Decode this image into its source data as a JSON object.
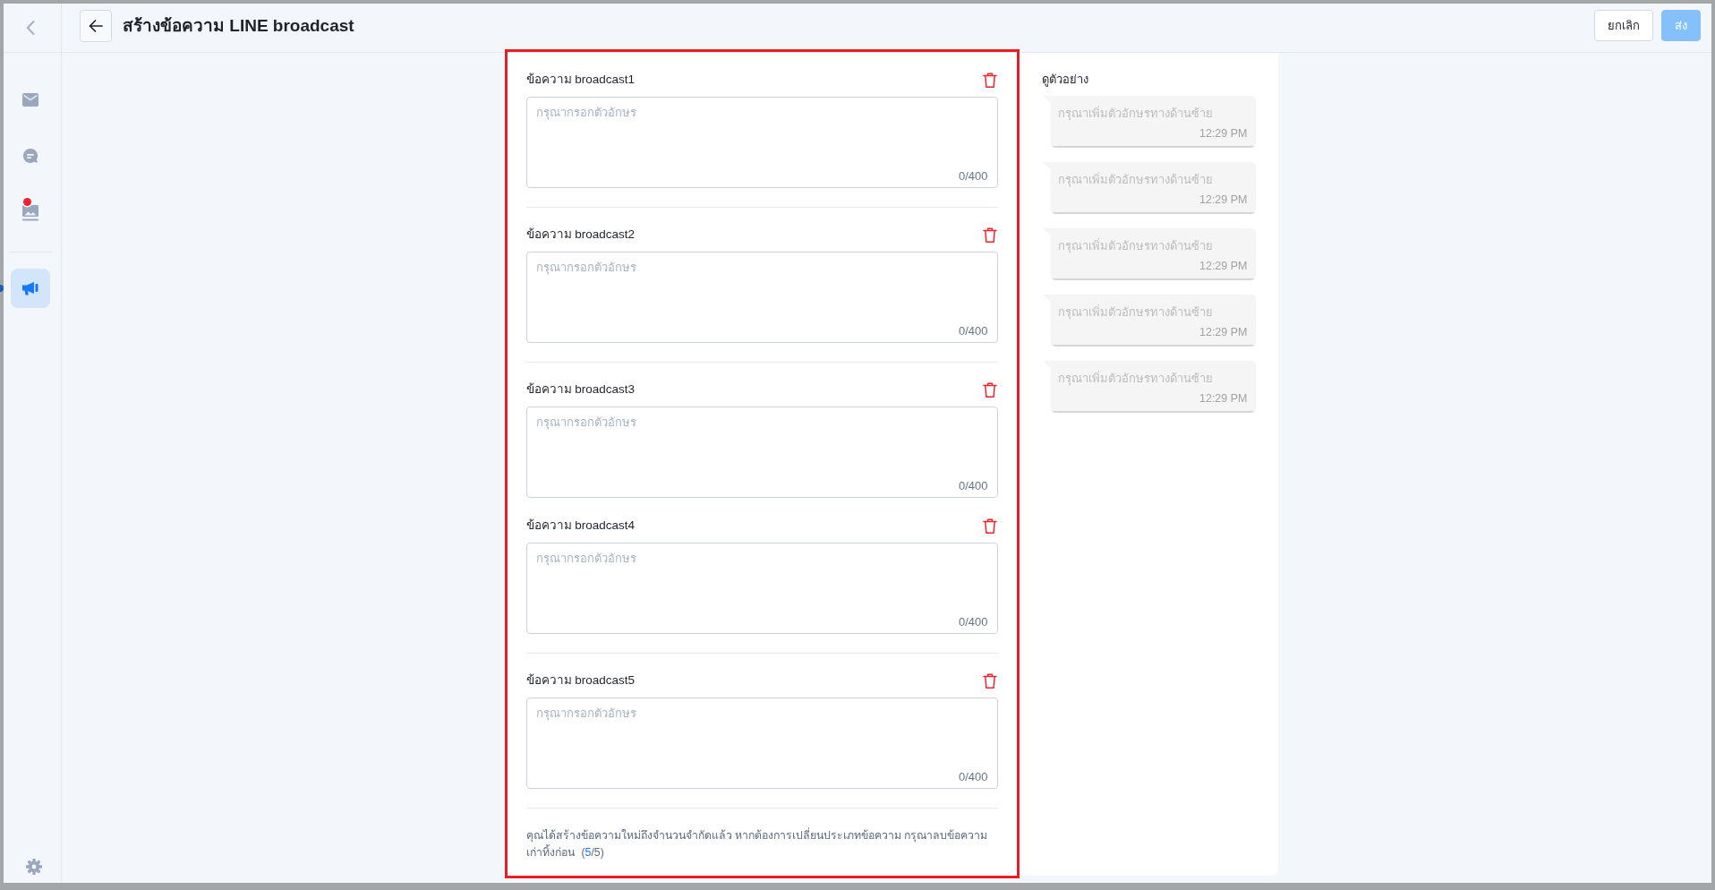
{
  "sidebar": {
    "sections": [
      {
        "items": [
          {
            "kind": "mail",
            "selected": false,
            "badge": false
          },
          {
            "kind": "chat",
            "selected": false,
            "badge": false
          },
          {
            "kind": "image",
            "selected": false,
            "badge": true
          }
        ]
      },
      {
        "items": [
          {
            "kind": "megaphone",
            "selected": true,
            "badge": false
          }
        ]
      }
    ]
  },
  "header": {
    "title": "สร้างข้อความ LINE broadcast",
    "buttons": [
      {
        "label": "ยกเลิก",
        "kind": "secondary",
        "disabled": false
      },
      {
        "label": "ส่ง",
        "kind": "primary",
        "disabled": true
      }
    ]
  },
  "messages": [
    {
      "label": "ข้อความ broadcast1",
      "placeholder": "กรุณากรอกตัวอักษร",
      "counter": "0/400",
      "separator": true
    },
    {
      "label": "ข้อความ broadcast2",
      "placeholder": "กรุณากรอกตัวอักษร",
      "counter": "0/400",
      "separator": true
    },
    {
      "label": "ข้อความ broadcast3",
      "placeholder": "กรุณากรอกตัวอักษร",
      "counter": "0/400",
      "separator": false
    },
    {
      "label": "ข้อความ broadcast4",
      "placeholder": "กรุณากรอกตัวอักษร",
      "counter": "0/400",
      "separator": true
    },
    {
      "label": "ข้อความ broadcast5",
      "placeholder": "กรุณากรอกตัวอักษร",
      "counter": "0/400",
      "separator": true
    }
  ],
  "notice": {
    "text": "คุณได้สร้างข้อความใหม่ถึงจำนวนจำกัดแล้ว หากต้องการเปลี่ยนประเภทข้อความ กรุณาลบข้อความเก่าทิ้งก่อน",
    "counter_open": "(",
    "counter_used": "5",
    "counter_rest": "/5)"
  },
  "preview": {
    "title": "ดูตัวอย่าง",
    "bubbles": [
      {
        "text": "กรุณาเพิ่มตัวอักษรทางด้านซ้าย",
        "time": "12:29 PM"
      },
      {
        "text": "กรุณาเพิ่มตัวอักษรทางด้านซ้าย",
        "time": "12:29 PM"
      },
      {
        "text": "กรุณาเพิ่มตัวอักษรทางด้านซ้าย",
        "time": "12:29 PM"
      },
      {
        "text": "กรุณาเพิ่มตัวอักษรทางด้านซ้าย",
        "time": "12:29 PM"
      },
      {
        "text": "กรุณาเพิ่มตัวอักษรทางด้านซ้าย",
        "time": "12:29 PM"
      }
    ]
  }
}
